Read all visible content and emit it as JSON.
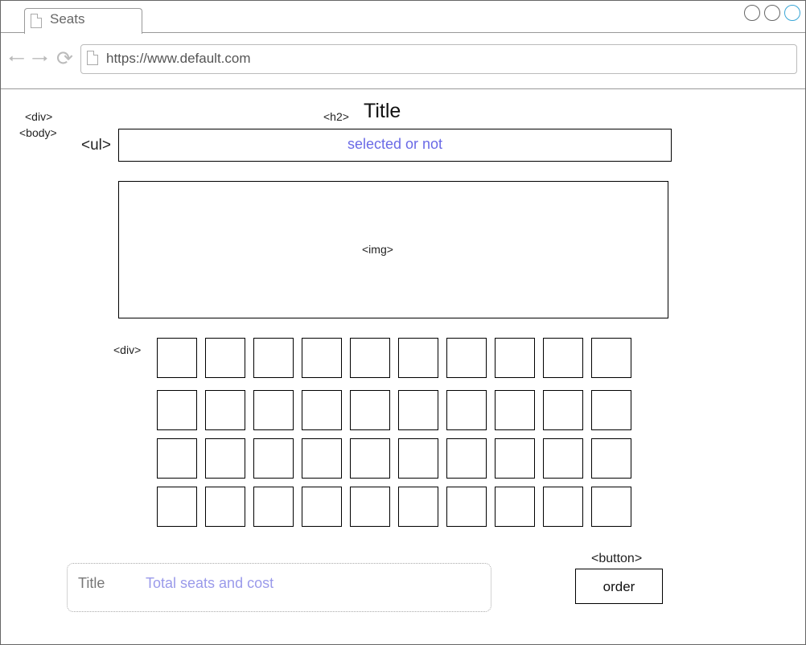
{
  "browser": {
    "tab_title": "Seats",
    "url": "https://www.default.com"
  },
  "annotations": {
    "div_outer": "<div>",
    "body": "<body>",
    "h2": "<h2>",
    "ul": "<ul>",
    "img": "<img>",
    "div_seats": "<div>",
    "button": "<button>"
  },
  "header": {
    "title": "Title",
    "selection_text": "selected or not"
  },
  "seats": {
    "rows": 4,
    "cols": 10
  },
  "summary": {
    "title": "Title",
    "text": "Total seats and cost"
  },
  "order": {
    "label": "order"
  }
}
